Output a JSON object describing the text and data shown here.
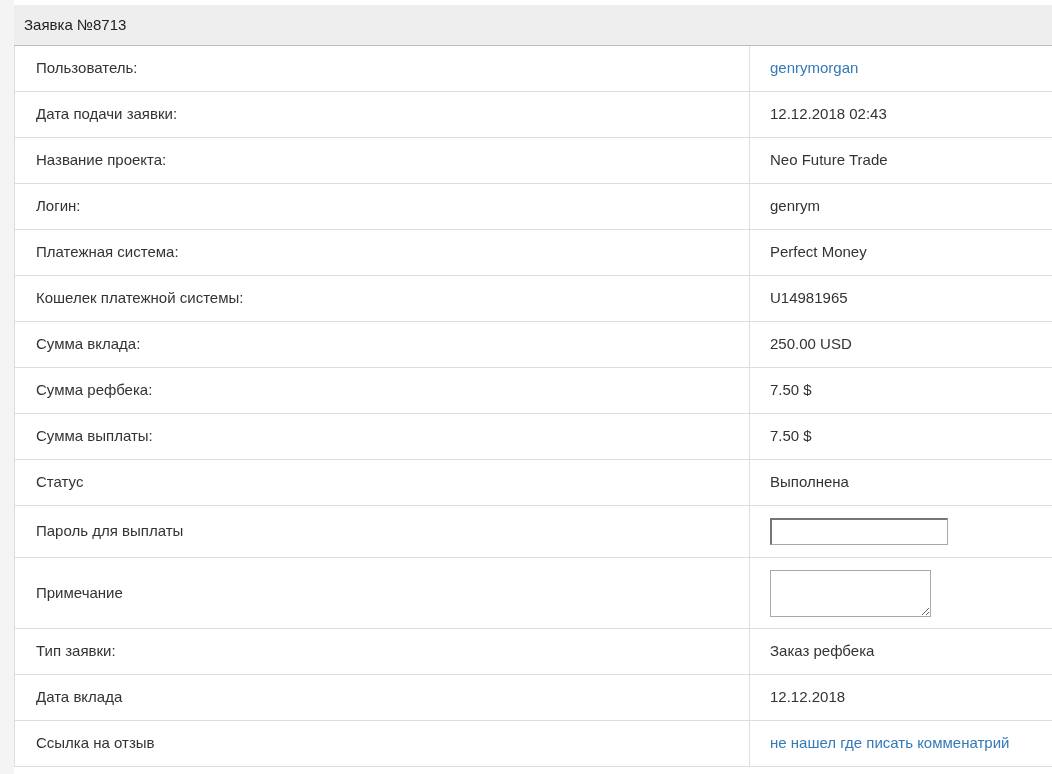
{
  "panel": {
    "title": "Заявка №8713"
  },
  "rows": [
    {
      "label": "Пользователь:",
      "kind": "link",
      "value": "genrymorgan"
    },
    {
      "label": "Дата подачи заявки:",
      "kind": "text",
      "value": "12.12.2018 02:43"
    },
    {
      "label": "Название проекта:",
      "kind": "text",
      "value": "Neo Future Trade"
    },
    {
      "label": "Логин:",
      "kind": "text",
      "value": "genrym"
    },
    {
      "label": "Платежная система:",
      "kind": "text",
      "value": "Perfect Money"
    },
    {
      "label": "Кошелек платежной системы:",
      "kind": "text",
      "value": "U14981965"
    },
    {
      "label": "Сумма вклада:",
      "kind": "text",
      "value": "250.00 USD"
    },
    {
      "label": "Сумма рефбека:",
      "kind": "text",
      "value": "7.50 $"
    },
    {
      "label": "Сумма выплаты:",
      "kind": "text",
      "value": "7.50 $"
    },
    {
      "label": "Статус",
      "kind": "text",
      "value": "Выполнена"
    },
    {
      "label": "Пароль для выплаты",
      "kind": "password"
    },
    {
      "label": "Примечание",
      "kind": "textarea"
    },
    {
      "label": "Тип заявки:",
      "kind": "text",
      "value": "Заказ рефбека"
    },
    {
      "label": "Дата вклада",
      "kind": "text",
      "value": "12.12.2018"
    },
    {
      "label": "Ссылка на отзыв",
      "kind": "link",
      "value": "не нашел где писать комменатрий"
    }
  ]
}
